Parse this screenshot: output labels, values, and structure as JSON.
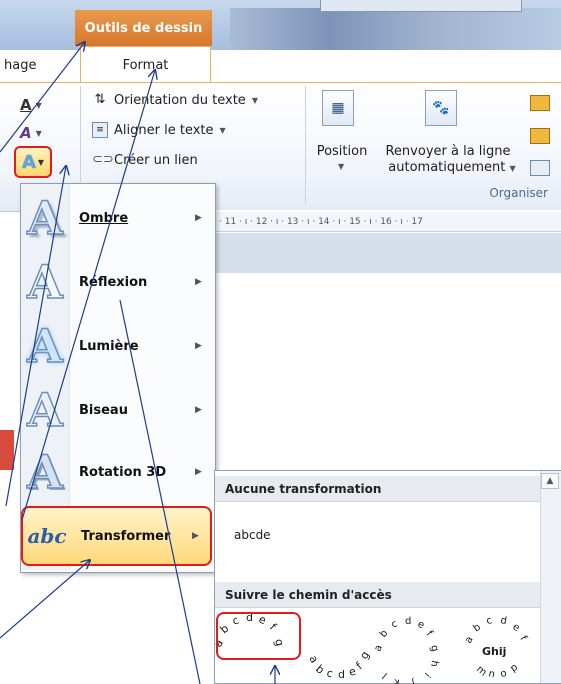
{
  "ribbon": {
    "context_tab_header": "Outils de dessin",
    "tab_left_partial": "hage",
    "tab_format": "Format",
    "text_direction_label": "Orientation du texte",
    "align_text_label": "Aligner le texte",
    "create_link_label": "Créer un lien",
    "position_label": "Position",
    "wrap_text_label_1": "Renvoyer à la ligne",
    "wrap_text_label_2": "automatiquement",
    "group_organiser": "Organiser",
    "ruler_text": "· 11 · ı · 12 · ı · 13 · ı · 14 · ı · 15 · ı · 16 · ı · 17"
  },
  "menu": {
    "items": [
      {
        "label": "Ombre",
        "icon": "shadow-a-icon"
      },
      {
        "label": "Réflexion",
        "icon": "reflection-a-icon"
      },
      {
        "label": "Lumière",
        "icon": "glow-a-icon"
      },
      {
        "label": "Biseau",
        "icon": "bevel-a-icon"
      },
      {
        "label": "Rotation 3D",
        "icon": "rotation3d-a-icon"
      },
      {
        "label": "Transformer",
        "icon": "transform-abc-icon"
      }
    ]
  },
  "submenu": {
    "section_no_transform": "Aucune transformation",
    "sample_text": "abcde",
    "section_follow_path": "Suivre le chemin d'accès",
    "warp_sample_3_center": "Ghij"
  },
  "colors": {
    "highlight_red": "#e21b1b",
    "context_orange": "#d8772b",
    "arrow_blue": "#1f3d8c"
  }
}
